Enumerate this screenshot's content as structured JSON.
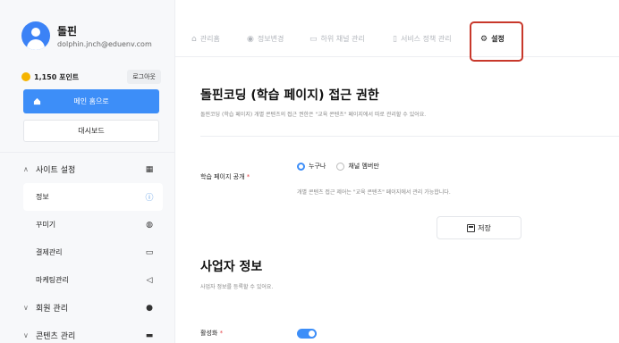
{
  "profile": {
    "name": "돌핀",
    "email": "dolphin.jnch@eduenv.com"
  },
  "points": {
    "label": "1,150 포인트",
    "logout_label": "로그아웃"
  },
  "sidebar": {
    "main_home_label": "메인 홈으로",
    "dashboard_label": "대시보드",
    "items": [
      {
        "label": "사이트 설정",
        "icon": "building-icon",
        "chevron": "∧"
      },
      {
        "label": "정보",
        "icon": "info-icon"
      },
      {
        "label": "꾸미기",
        "icon": "palette-icon"
      },
      {
        "label": "결제관리",
        "icon": "card-icon"
      },
      {
        "label": "마케팅관리",
        "icon": "megaphone-icon"
      },
      {
        "label": "회원 관리",
        "icon": "user-icon",
        "chevron": "∨"
      },
      {
        "label": "콘텐츠 관리",
        "icon": "book-icon",
        "chevron": "∨"
      }
    ]
  },
  "topnav": {
    "tabs": [
      {
        "label": "관리홈",
        "icon": "home-icon"
      },
      {
        "label": "정보변경",
        "icon": "user-icon"
      },
      {
        "label": "하위 채널 관리",
        "icon": "folder-icon"
      },
      {
        "label": "서비스 정책 관리",
        "icon": "document-icon"
      },
      {
        "label": "설정",
        "icon": "gear-icon"
      }
    ]
  },
  "access": {
    "title": "돌핀코딩 (학습 페이지) 접근 권한",
    "description": "돌핀코딩 (학습 페이지) 개별 콘텐츠의 접근 권한은 \"교육 콘텐츠\" 페이지에서 따로 관리할 수 있어요.",
    "field_label": "학습 페이지 공개",
    "required_mark": "*",
    "options": [
      "누구나",
      "채널 멤버만"
    ],
    "selected": "누구나",
    "hint": "개별 콘텐츠 접근 제어는 \"교육 콘텐츠\" 페이지에서 관리 가능합니다.",
    "save_label": "저장"
  },
  "business": {
    "title": "사업자 정보",
    "description": "사업자 정보를 등록할 수 있어요.",
    "field_label": "활성화",
    "required_mark": "*",
    "toggle_on": true
  },
  "colors": {
    "accent": "#3d8ef8",
    "highlight": "#c8382b",
    "required": "#e5484d"
  }
}
